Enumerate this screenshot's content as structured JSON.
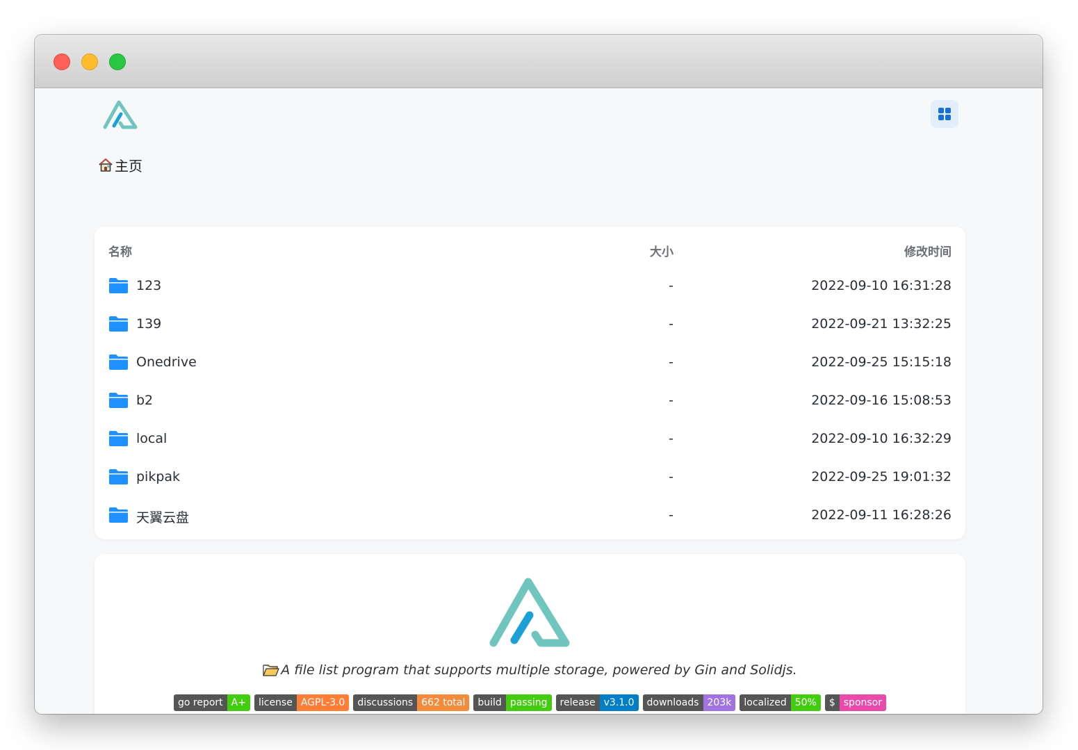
{
  "breadcrumb": {
    "home_label": "主页"
  },
  "table": {
    "headers": {
      "name": "名称",
      "size": "大小",
      "modified": "修改时间"
    },
    "rows": [
      {
        "name": "123",
        "size": "-",
        "modified": "2022-09-10 16:31:28"
      },
      {
        "name": "139",
        "size": "-",
        "modified": "2022-09-21 13:32:25"
      },
      {
        "name": "Onedrive",
        "size": "-",
        "modified": "2022-09-25 15:15:18"
      },
      {
        "name": "b2",
        "size": "-",
        "modified": "2022-09-16 15:08:53"
      },
      {
        "name": "local",
        "size": "-",
        "modified": "2022-09-10 16:32:29"
      },
      {
        "name": "pikpak",
        "size": "-",
        "modified": "2022-09-25 19:01:32"
      },
      {
        "name": "天翼云盘",
        "size": "-",
        "modified": "2022-09-11 16:28:26"
      }
    ]
  },
  "readme": {
    "tagline": "A file list program that supports multiple storage, powered by Gin and Solidjs.",
    "badges": [
      {
        "label": "go report",
        "value": "A+",
        "color": "#44cc11"
      },
      {
        "label": "license",
        "value": "AGPL-3.0",
        "color": "#fe7d37"
      },
      {
        "label": "discussions",
        "value": "662 total",
        "color": "#f28b3c"
      },
      {
        "label": "build",
        "value": "passing",
        "color": "#44cc11"
      },
      {
        "label": "release",
        "value": "v3.1.0",
        "color": "#007ec6"
      },
      {
        "label": "downloads",
        "value": "203k",
        "color": "#a073e0"
      },
      {
        "label": "localized",
        "value": "50%",
        "color": "#44cc11"
      },
      {
        "label": "$",
        "value": "sponsor",
        "color": "#ea4aaa"
      }
    ]
  },
  "icons": {
    "logo": "alist-logo",
    "layout": "grid-layout-icon",
    "home": "house-icon",
    "folder": "folder-icon"
  },
  "colors": {
    "accent": "#1e90ff",
    "logo_teal": "#70c6be",
    "logo_blue": "#1ba0d8"
  }
}
